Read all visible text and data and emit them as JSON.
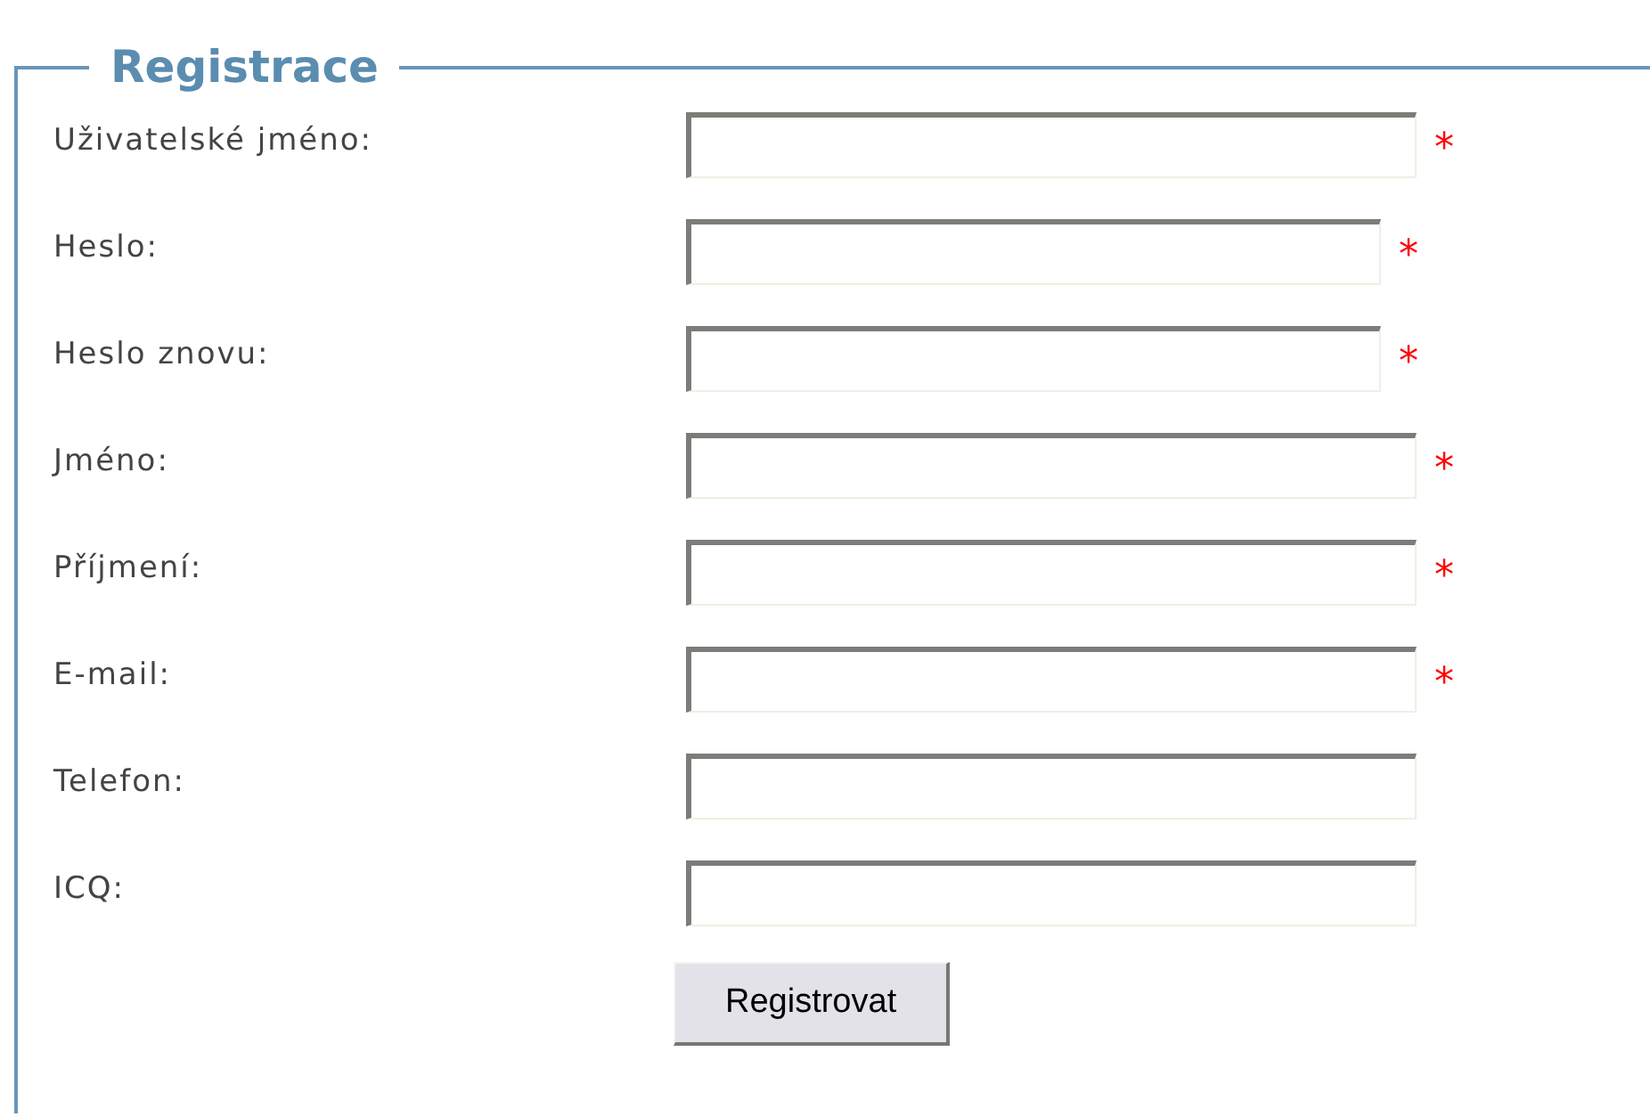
{
  "form": {
    "title": "Registrace",
    "fields": [
      {
        "label": "Uživatelské jméno:",
        "kind": "text",
        "required_mark": "*"
      },
      {
        "label": "Heslo:",
        "kind": "password",
        "required_mark": "*"
      },
      {
        "label": "Heslo znovu:",
        "kind": "password",
        "required_mark": "*"
      },
      {
        "label": "Jméno:",
        "kind": "text",
        "required_mark": "*"
      },
      {
        "label": "Příjmení:",
        "kind": "text",
        "required_mark": "*"
      },
      {
        "label": "E-mail:",
        "kind": "text",
        "required_mark": "*"
      },
      {
        "label": "Telefon:",
        "kind": "text"
      },
      {
        "label": "ICQ:",
        "kind": "text"
      }
    ],
    "submit": "Registrovat"
  }
}
